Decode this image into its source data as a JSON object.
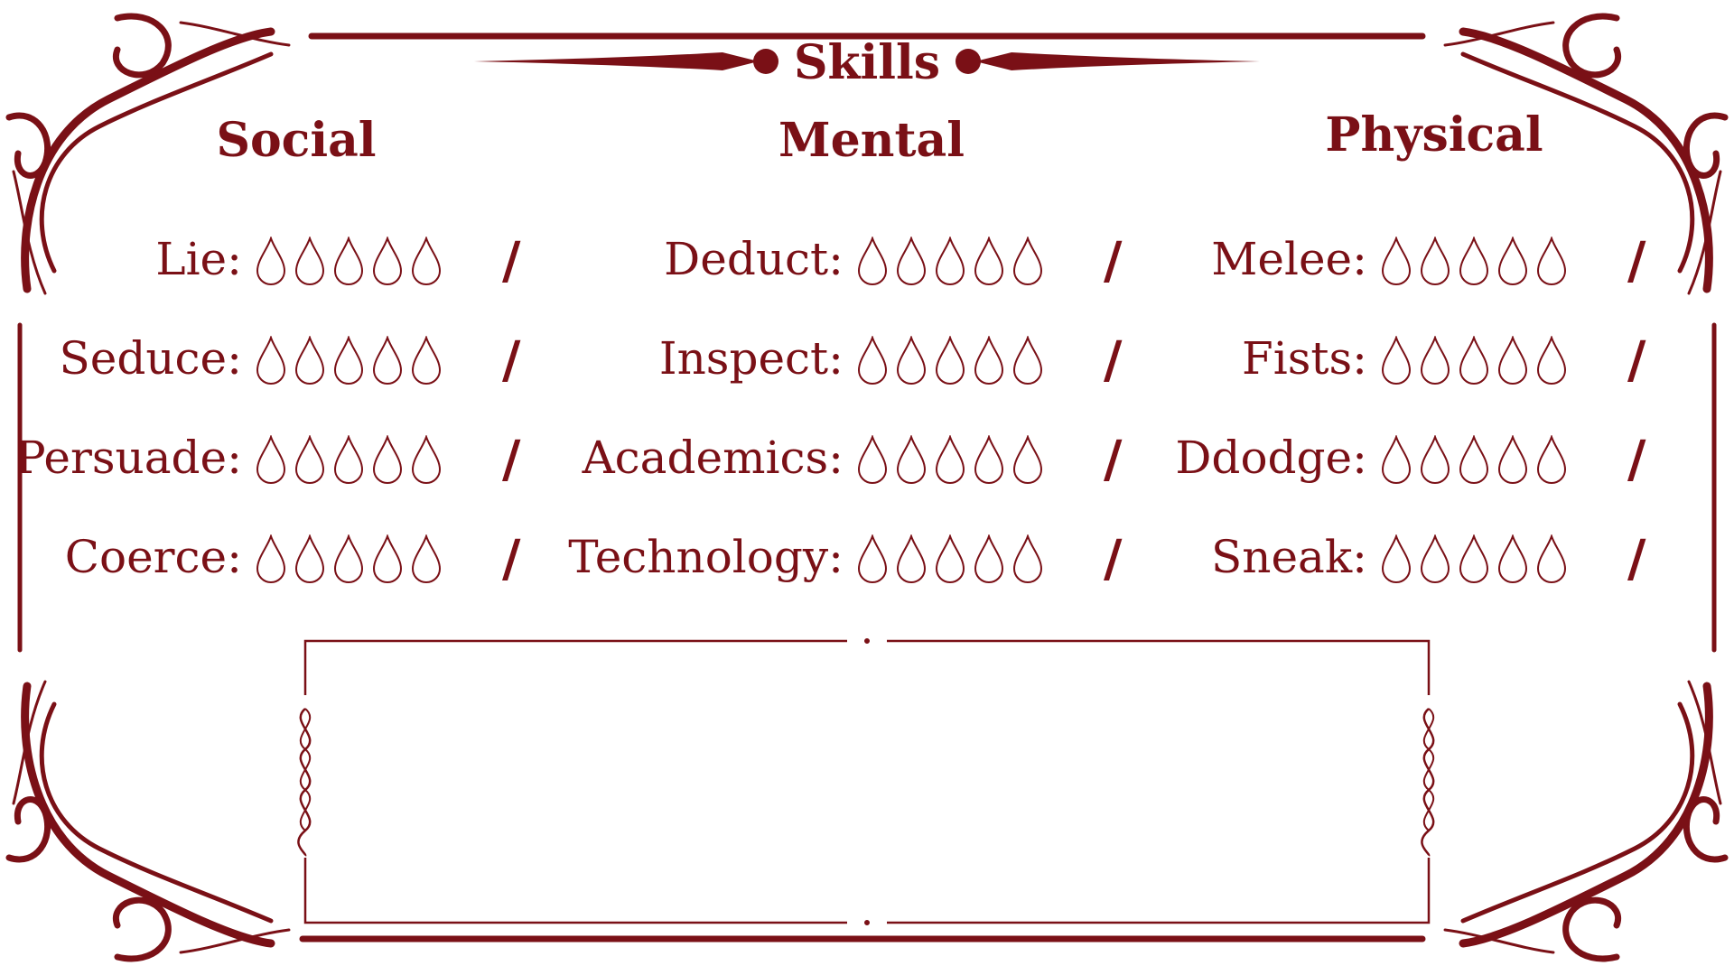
{
  "sheet": {
    "title": "Skills",
    "accent_color": "#7a1016",
    "max_rating": 5
  },
  "columns": [
    {
      "heading": "Social",
      "skills": [
        {
          "label": "Lie:",
          "rating": 0
        },
        {
          "label": "Seduce:",
          "rating": 0
        },
        {
          "label": "Persuade:",
          "rating": 0
        },
        {
          "label": "Coerce:",
          "rating": 0
        }
      ]
    },
    {
      "heading": "Mental",
      "skills": [
        {
          "label": "Deduct:",
          "rating": 0
        },
        {
          "label": "Inspect:",
          "rating": 0
        },
        {
          "label": "Academics:",
          "rating": 0
        },
        {
          "label": "Technology:",
          "rating": 0
        }
      ]
    },
    {
      "heading": "Physical",
      "skills": [
        {
          "label": "Melee:",
          "rating": 0
        },
        {
          "label": "Fists:",
          "rating": 0
        },
        {
          "label": "Ddodge:",
          "rating": 0
        },
        {
          "label": "Sneak:",
          "rating": 0
        }
      ]
    }
  ],
  "slash_mark": "/",
  "notes": {
    "text": ""
  },
  "icons": {
    "pip": "blood-drop-outline-icon",
    "corner": "scroll-flourish-icon",
    "title_divider": "ornate-rule-icon"
  }
}
